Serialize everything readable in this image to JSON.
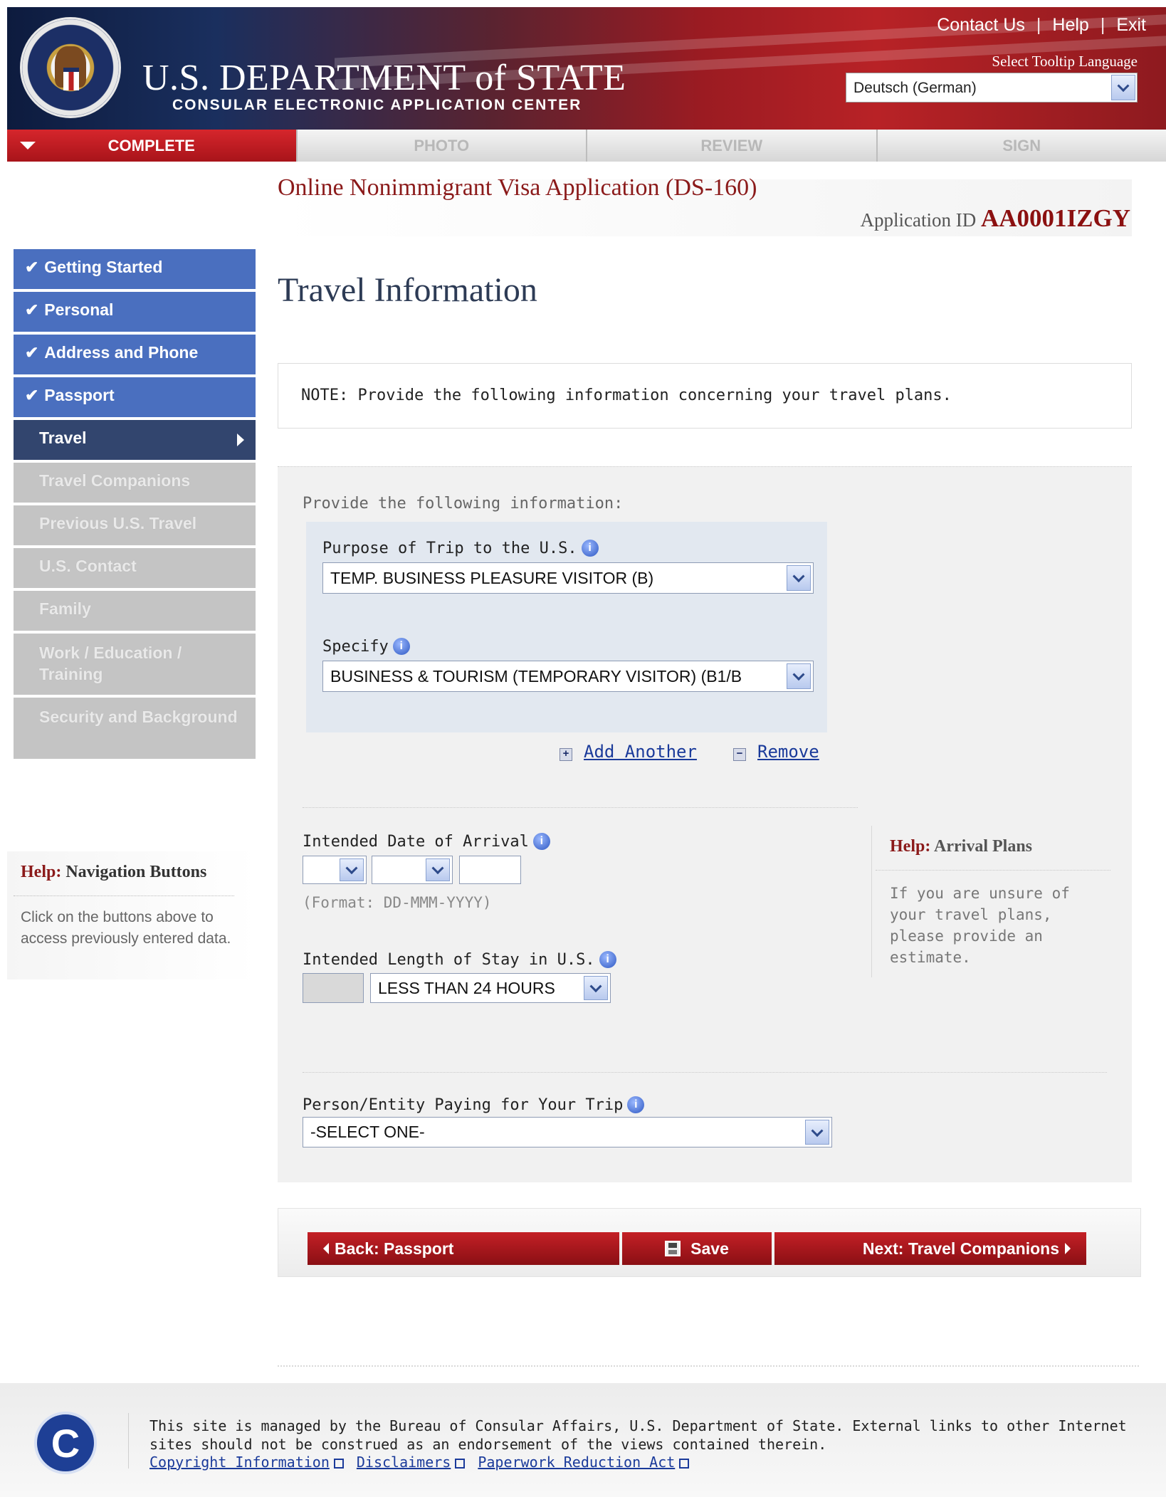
{
  "header": {
    "top_links": [
      "Contact Us",
      "Help",
      "Exit"
    ],
    "dept_title": "U.S. DEPARTMENT of STATE",
    "dept_subtitle": "CONSULAR ELECTRONIC APPLICATION CENTER",
    "tooltip_language_label": "Select Tooltip Language",
    "tooltip_language_value": "Deutsch (German)"
  },
  "progress": {
    "steps": [
      "COMPLETE",
      "PHOTO",
      "REVIEW",
      "SIGN"
    ],
    "active": "COMPLETE"
  },
  "app": {
    "title": "Online Nonimmigrant Visa Application (DS-160)",
    "id_label": "Application ID",
    "id_value": "AA0001IZGY"
  },
  "nav": {
    "items": [
      {
        "label": "Getting Started",
        "state": "done"
      },
      {
        "label": "Personal",
        "state": "done"
      },
      {
        "label": "Address and Phone",
        "state": "done"
      },
      {
        "label": "Passport",
        "state": "done"
      },
      {
        "label": "Travel",
        "state": "current"
      },
      {
        "label": "Travel Companions",
        "state": "todo"
      },
      {
        "label": "Previous U.S. Travel",
        "state": "todo"
      },
      {
        "label": "U.S. Contact",
        "state": "todo"
      },
      {
        "label": "Family",
        "state": "todo"
      },
      {
        "label": "Work / Education / Training",
        "state": "todo"
      },
      {
        "label": "Security and Background",
        "state": "todo"
      }
    ],
    "check_glyph": "✔"
  },
  "help_nav": {
    "title_prefix": "Help:",
    "title": "Navigation Buttons",
    "body": "Click on the buttons above to access previously entered data."
  },
  "page": {
    "title": "Travel Information",
    "note": "NOTE: Provide the following information concerning your travel plans.",
    "provide_label": "Provide the following information:"
  },
  "form": {
    "purpose_label": "Purpose of Trip to the U.S.",
    "purpose_value": "TEMP. BUSINESS PLEASURE VISITOR (B)",
    "specify_label": "Specify",
    "specify_value": "BUSINESS & TOURISM (TEMPORARY VISITOR) (B1/B",
    "add_another": "Add Another",
    "remove": "Remove",
    "arrival_label": "Intended Date of Arrival",
    "arrival_day": "",
    "arrival_month": "",
    "arrival_year": "",
    "format_hint": "(Format: DD-MMM-YYYY)",
    "stay_label": "Intended Length of Stay in U.S.",
    "stay_number": "",
    "stay_unit": "LESS THAN 24 HOURS",
    "payer_label": "Person/Entity Paying for Your Trip",
    "payer_value": "-SELECT ONE-",
    "info_glyph": "i"
  },
  "help_arrival": {
    "title_prefix": "Help:",
    "title": "Arrival Plans",
    "body": "If you are unsure of your travel plans, please provide an estimate."
  },
  "buttons": {
    "back": "Back: Passport",
    "save": "Save",
    "next": "Next: Travel Companions"
  },
  "footer": {
    "text": "This site is managed by the Bureau of Consular Affairs, U.S. Department of State. External links to other Internet sites should not be construed as an endorsement of the views contained therein.",
    "links": [
      "Copyright Information",
      "Disclaimers",
      "Paperwork Reduction Act"
    ],
    "logo_letter": "C"
  },
  "colors": {
    "brand_red": "#a8141a",
    "nav_done": "#4a6fbf",
    "nav_current": "#32456e",
    "nav_todo": "#c4c4c4",
    "link_blue": "#1a3a9a"
  }
}
